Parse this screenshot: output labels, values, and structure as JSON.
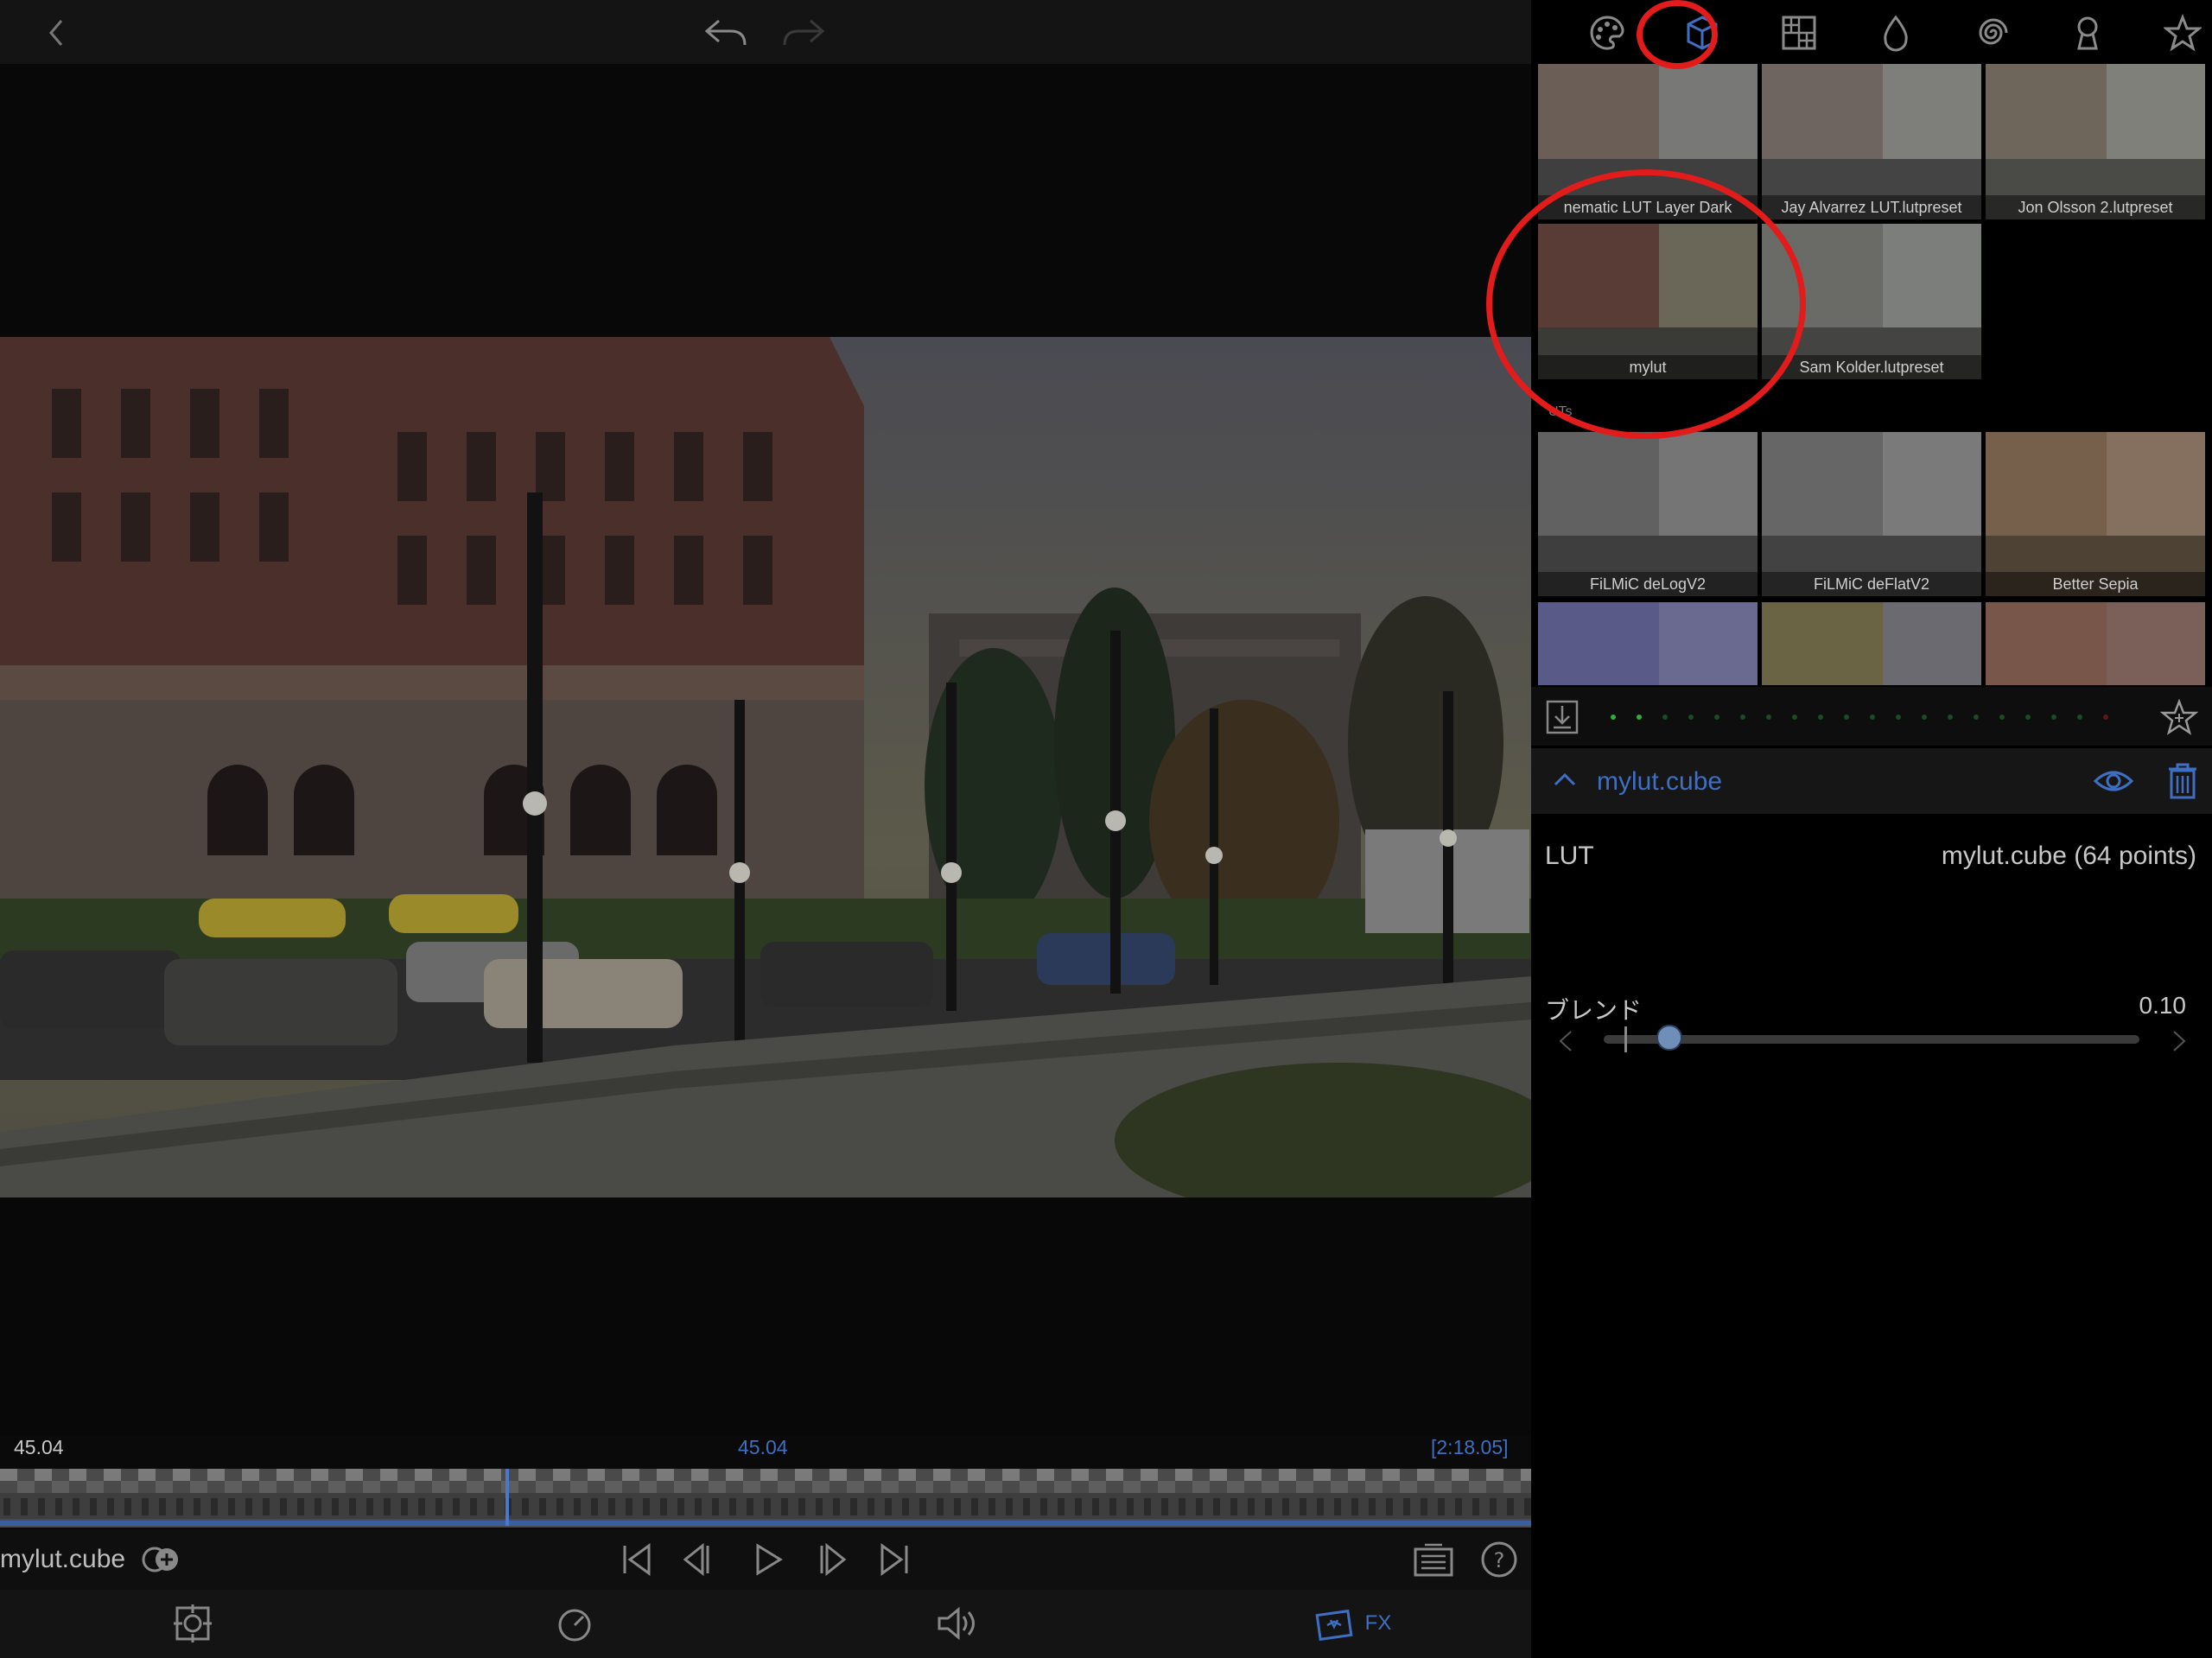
{
  "timeline": {
    "time_left": "45.04",
    "time_center": "45.04",
    "time_total": "[2:18.05]",
    "clip_name": "mylut.cube",
    "playhead_position": 0.33
  },
  "bottom_toolbar": {
    "fx_label": "FX"
  },
  "lut_browser": {
    "user_presets": [
      "nematic LUT Layer Dark",
      "Jay Alvarrez LUT.lutpreset",
      "Jon Olsson 2.lutpreset",
      "mylut",
      "Sam Kolder.lutpreset"
    ],
    "section_label": "UTs",
    "builtin_luts": [
      "FiLMiC deLogV2",
      "FiLMiC deFlatV2",
      "Better Sepia"
    ]
  },
  "lut_panel": {
    "header_name": "mylut.cube",
    "lut_label": "LUT",
    "lut_value": "mylut.cube (64 points)",
    "blend_label": "ブレンド",
    "blend_value": "0.10",
    "blend_fraction": 0.1
  },
  "colors": {
    "accent_blue": "#3f6fc2",
    "highlight_red": "#e21b1b",
    "panel_bg": "#000000"
  }
}
